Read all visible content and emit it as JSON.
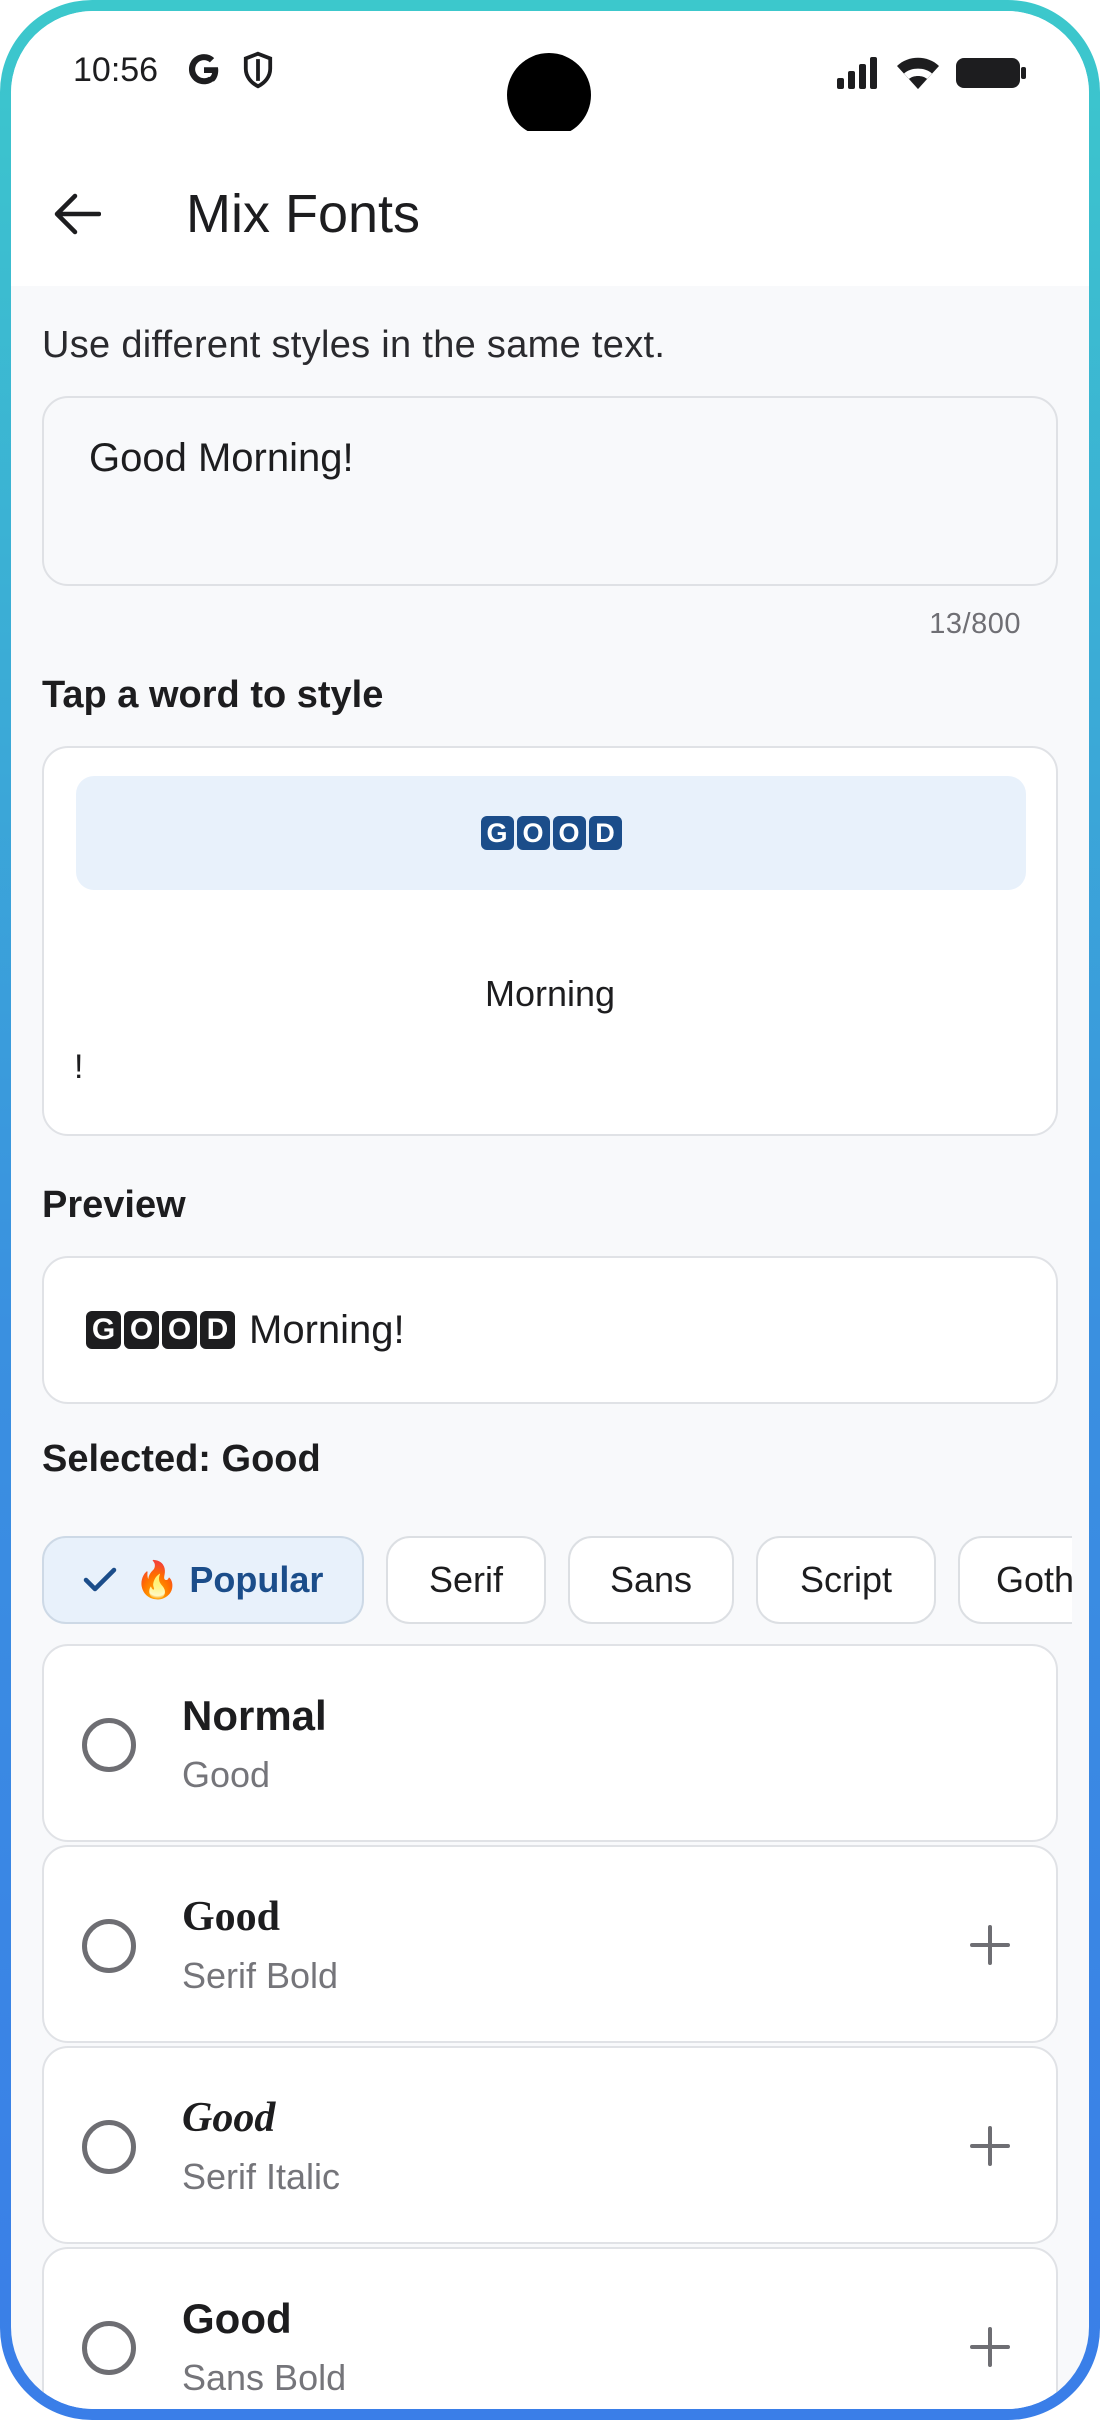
{
  "status_bar": {
    "time": "10:56"
  },
  "app_bar": {
    "title": "Mix Fonts"
  },
  "subtitle": "Use different styles in the same text.",
  "input": {
    "value": "Good Morning!",
    "char_count": "13/800"
  },
  "word_section": {
    "label": "Tap a word to style",
    "selected_word_letters": [
      "G",
      "O",
      "O",
      "D"
    ],
    "other_word": "Morning",
    "punctuation": "!"
  },
  "preview": {
    "label": "Preview",
    "styled_letters": [
      "G",
      "O",
      "O",
      "D"
    ],
    "rest_text": "Morning!"
  },
  "selected": {
    "label": "Selected: Good"
  },
  "categories": [
    {
      "label": "🔥 Popular",
      "active": true
    },
    {
      "label": "Serif",
      "active": false
    },
    {
      "label": "Sans",
      "active": false
    },
    {
      "label": "Script",
      "active": false
    },
    {
      "label": "Gothic",
      "active": false
    }
  ],
  "styles": [
    {
      "name": "Normal",
      "sample": "Good",
      "has_add": false
    },
    {
      "name": "Good",
      "sample": "Serif Bold",
      "has_add": true
    },
    {
      "name": "Good",
      "sample": "Serif Italic",
      "has_add": true
    },
    {
      "name": "Good",
      "sample": "Sans Bold",
      "has_add": true
    }
  ],
  "colors": {
    "accent": "#1b4d8a",
    "accent_bg": "#e8f1fb",
    "frame_top": "#3cc8cc",
    "frame_bottom": "#3a7ee8"
  }
}
